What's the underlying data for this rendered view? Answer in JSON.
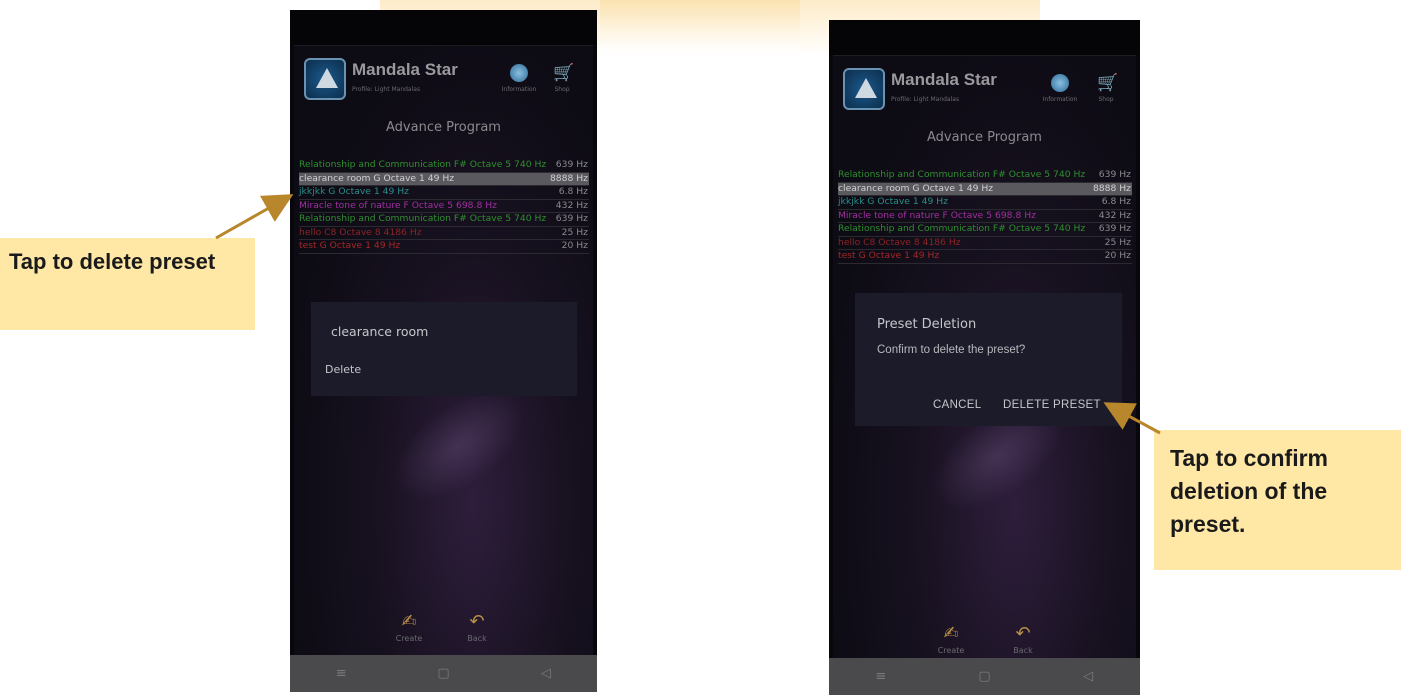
{
  "callouts": {
    "left": "Tap to delete preset",
    "right": "Tap to confirm deletion of the preset."
  },
  "app": {
    "title": "Mandala Star",
    "profile": "Profile: Light Mandalas",
    "info_label": "Information",
    "shop_label": "Shop",
    "section_title": "Advance Program",
    "create_label": "Create",
    "back_label": "Back"
  },
  "presets": [
    {
      "name": "Relationship and Communication  F# Octave 5 740 Hz",
      "hz": "639 Hz",
      "color": "#2f8f2f"
    },
    {
      "name": "clearance room  G Octave 1 49 Hz",
      "hz": "8888 Hz",
      "color": "#d0d0d4",
      "selected": true
    },
    {
      "name": "jkkjkk G Octave 1 49 Hz",
      "hz": "6.8 Hz",
      "color": "#2a8d8a"
    },
    {
      "name": "Miracle tone of nature F Octave 5 698.8 Hz",
      "hz": "432 Hz",
      "color": "#a02fa0"
    },
    {
      "name": "Relationship and Communication  F# Octave 5 740 Hz",
      "hz": "639 Hz",
      "color": "#2f8f2f"
    },
    {
      "name": "hello C8 Octave 8 4186 Hz",
      "hz": "25 Hz",
      "color": "#8a2424"
    },
    {
      "name": "test G Octave 1 49 Hz",
      "hz": "20 Hz",
      "color": "#a52727"
    }
  ],
  "delete_menu": {
    "title": "clearance room",
    "delete_label": "Delete"
  },
  "confirm_dialog": {
    "title": "Preset Deletion",
    "message": "Confirm to delete the preset?",
    "cancel_label": "CANCEL",
    "delete_label": "DELETE PRESET"
  },
  "navbar": {
    "menu_icon": "≡",
    "home_icon": "▢",
    "back_icon": "◁"
  },
  "colors": {
    "callout_bg": "#ffe8a6",
    "arrow": "#b8862b",
    "dialog_bg": "#1b1b2a"
  }
}
